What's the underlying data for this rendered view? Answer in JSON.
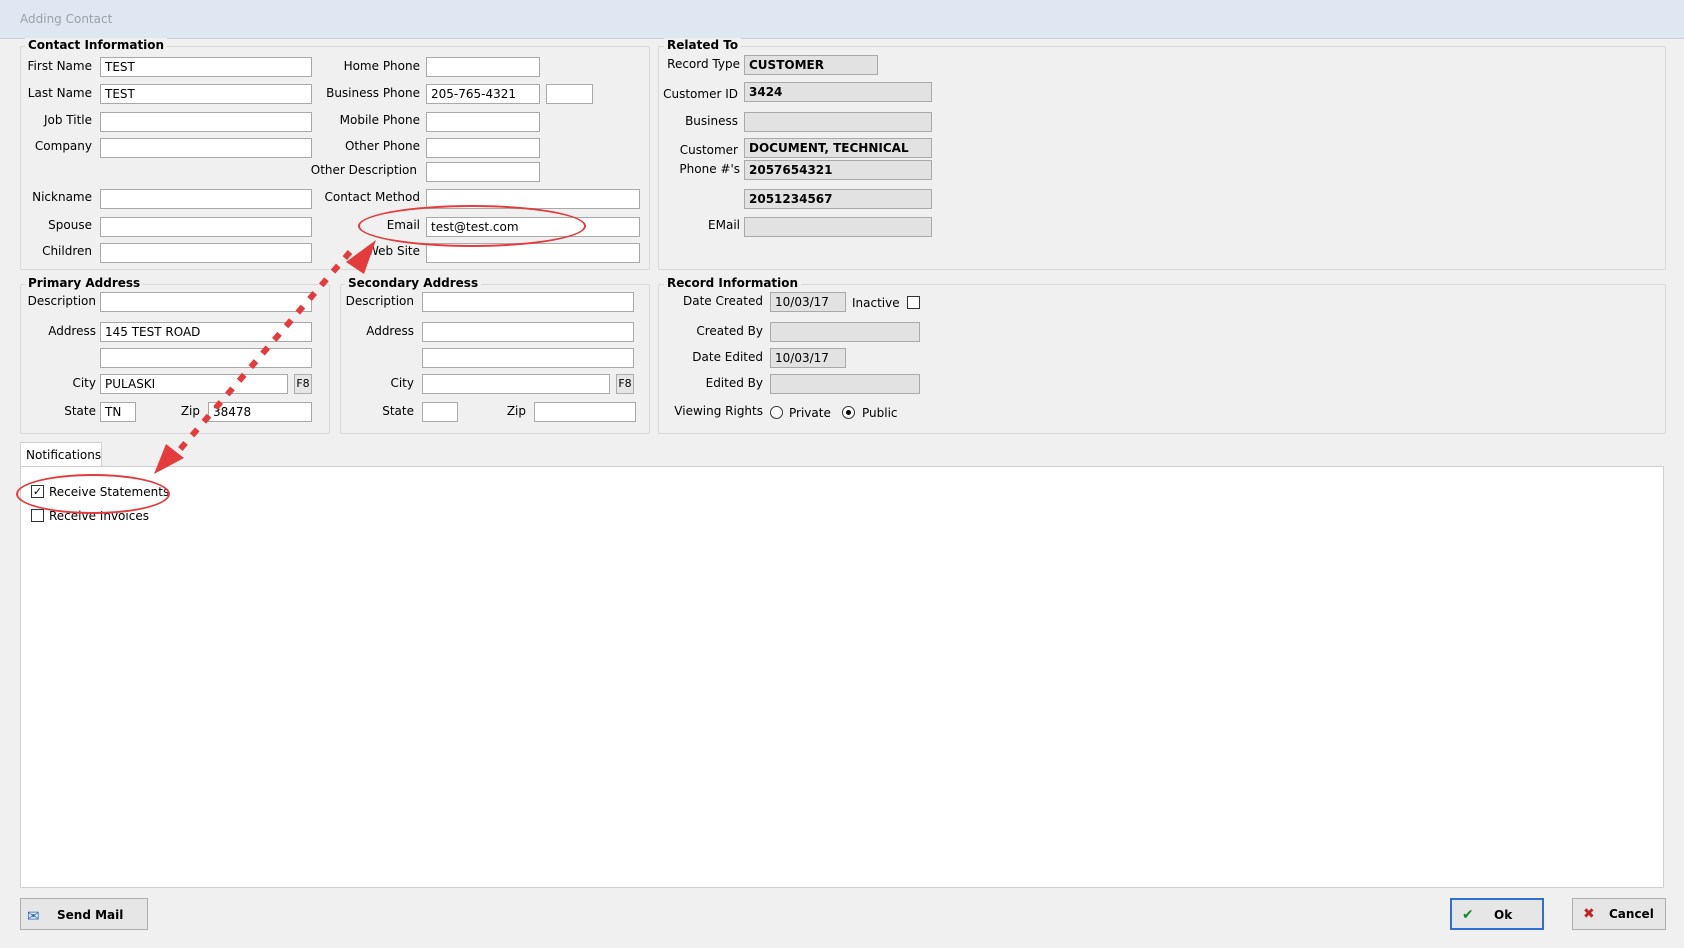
{
  "window": {
    "title": "Adding Contact"
  },
  "contact": {
    "title": "Contact Information",
    "first_name_label": "First Name",
    "first_name": "TEST",
    "last_name_label": "Last Name",
    "last_name": "TEST",
    "job_title_label": "Job Title",
    "job_title": "",
    "company_label": "Company",
    "company": "",
    "nickname_label": "Nickname",
    "nickname": "",
    "spouse_label": "Spouse",
    "spouse": "",
    "children_label": "Children",
    "children": "",
    "home_phone_label": "Home Phone",
    "home_phone": "",
    "business_phone_label": "Business Phone",
    "business_phone": "205-765-4321",
    "business_ext": "",
    "mobile_phone_label": "Mobile Phone",
    "mobile_phone": "",
    "other_phone_label": "Other Phone",
    "other_phone": "",
    "other_description_label": "Other Description",
    "other_description": "",
    "contact_method_label": "Contact Method",
    "contact_method": "",
    "email_label": "Email",
    "email": "test@test.com",
    "website_label": "Web Site",
    "website": ""
  },
  "related": {
    "title": "Related To",
    "record_type_label": "Record Type",
    "record_type": "CUSTOMER",
    "customer_id_label": "Customer ID",
    "customer_id": "3424",
    "business_label": "Business",
    "business": "",
    "customer_label": "Customer",
    "customer": "DOCUMENT, TECHNICAL",
    "phones_label": "Phone #'s",
    "phone1": "2057654321",
    "phone2": "2051234567",
    "email_label": "EMail",
    "email": ""
  },
  "primary": {
    "title": "Primary Address",
    "description_label": "Description",
    "description": "",
    "address_label": "Address",
    "address1": "145 TEST ROAD",
    "address2": "",
    "city_label": "City",
    "city": "PULASKI",
    "f8": "F8",
    "state_label": "State",
    "state": "TN",
    "zip_label": "Zip",
    "zip": "38478"
  },
  "secondary": {
    "title": "Secondary Address",
    "description_label": "Description",
    "description": "",
    "address_label": "Address",
    "address1": "",
    "address2": "",
    "city_label": "City",
    "city": "",
    "f8": "F8",
    "state_label": "State",
    "state": "",
    "zip_label": "Zip",
    "zip": ""
  },
  "record": {
    "title": "Record Information",
    "date_created_label": "Date Created",
    "date_created": "10/03/17",
    "inactive_label": "Inactive",
    "created_by_label": "Created By",
    "created_by": "",
    "date_edited_label": "Date Edited",
    "date_edited": "10/03/17",
    "edited_by_label": "Edited By",
    "edited_by": "",
    "viewing_rights_label": "Viewing Rights",
    "private_label": "Private",
    "public_label": "Public"
  },
  "notifications": {
    "tab_label": "Notifications",
    "receive_statements": "Receive Statements",
    "receive_invoices": "Receive Invoices"
  },
  "buttons": {
    "send_mail": "Send Mail",
    "ok": "Ok",
    "cancel": "Cancel"
  },
  "colors": {
    "annotation": "#e23c3c"
  }
}
